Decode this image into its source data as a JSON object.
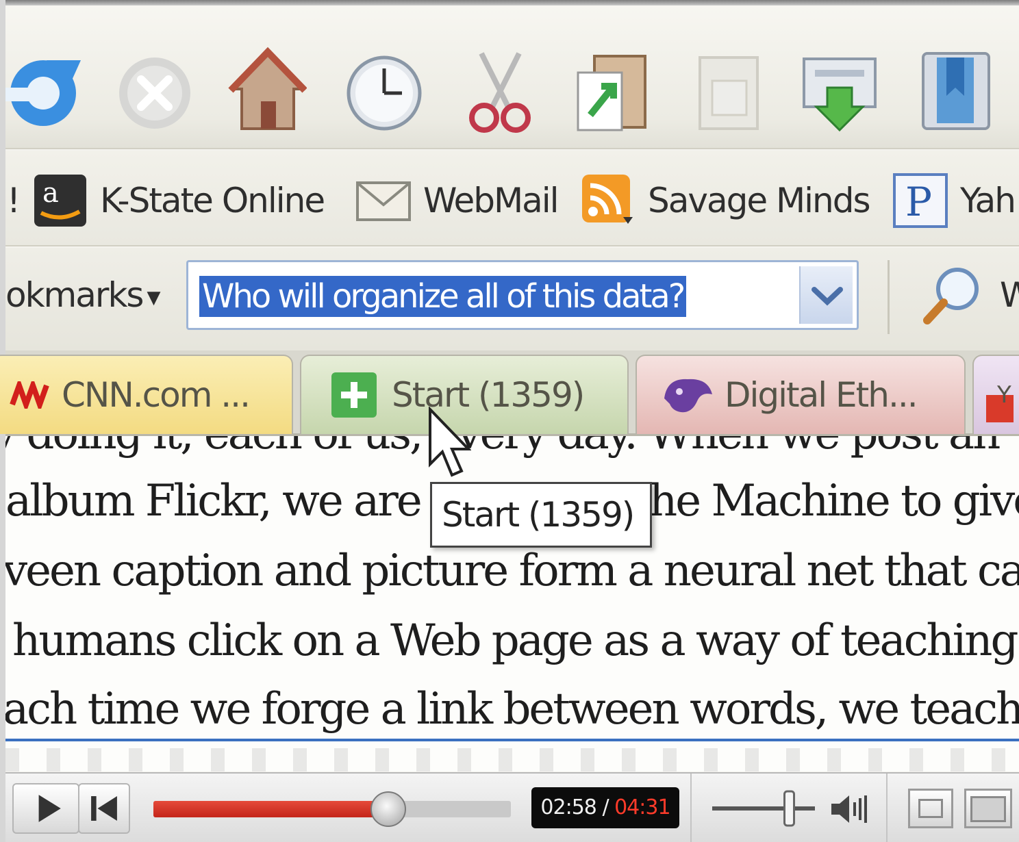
{
  "toolbar": {
    "icons": [
      "refresh-icon",
      "stop-icon",
      "home-icon",
      "history-icon",
      "cut-icon",
      "copy-icon",
      "paste-icon",
      "save-icon",
      "bookmark-icon"
    ]
  },
  "bookmarks": {
    "fragment_left": "!",
    "items": [
      {
        "label": "K-State Online",
        "icon": "amazon-icon"
      },
      {
        "label": "WebMail",
        "icon": "mail-icon"
      },
      {
        "label": "Savage Minds",
        "icon": "rss-icon"
      },
      {
        "label": "Yah",
        "icon": "p-icon"
      }
    ]
  },
  "search": {
    "bookmarks_menu": "okmarks",
    "value": "Who will organize all of this data?",
    "go_label": "W"
  },
  "tabs": [
    {
      "label": "CNN.com ...",
      "favicon": "cnn-icon"
    },
    {
      "label": "Start (1359)",
      "favicon": "plus-icon",
      "active": true
    },
    {
      "label": "Digital Eth...",
      "favicon": "kstate-wildcat-icon"
    },
    {
      "label": "Y",
      "favicon": "yahoo-icon"
    }
  ],
  "page": {
    "lines": [
      "album Flickr, we are",
      "he Machine to give",
      "veen caption and picture form a neural net that can l",
      "humans click on a Web page as a way of teaching",
      "ach time we forge a link between words, we teach"
    ]
  },
  "tooltip": {
    "text": "Start (1359)"
  },
  "player": {
    "current_time": "02:58",
    "separator": "/",
    "duration": "04:31",
    "progress_fraction": 0.657,
    "volume_fraction": 0.75,
    "accent_color": "#d93222"
  }
}
